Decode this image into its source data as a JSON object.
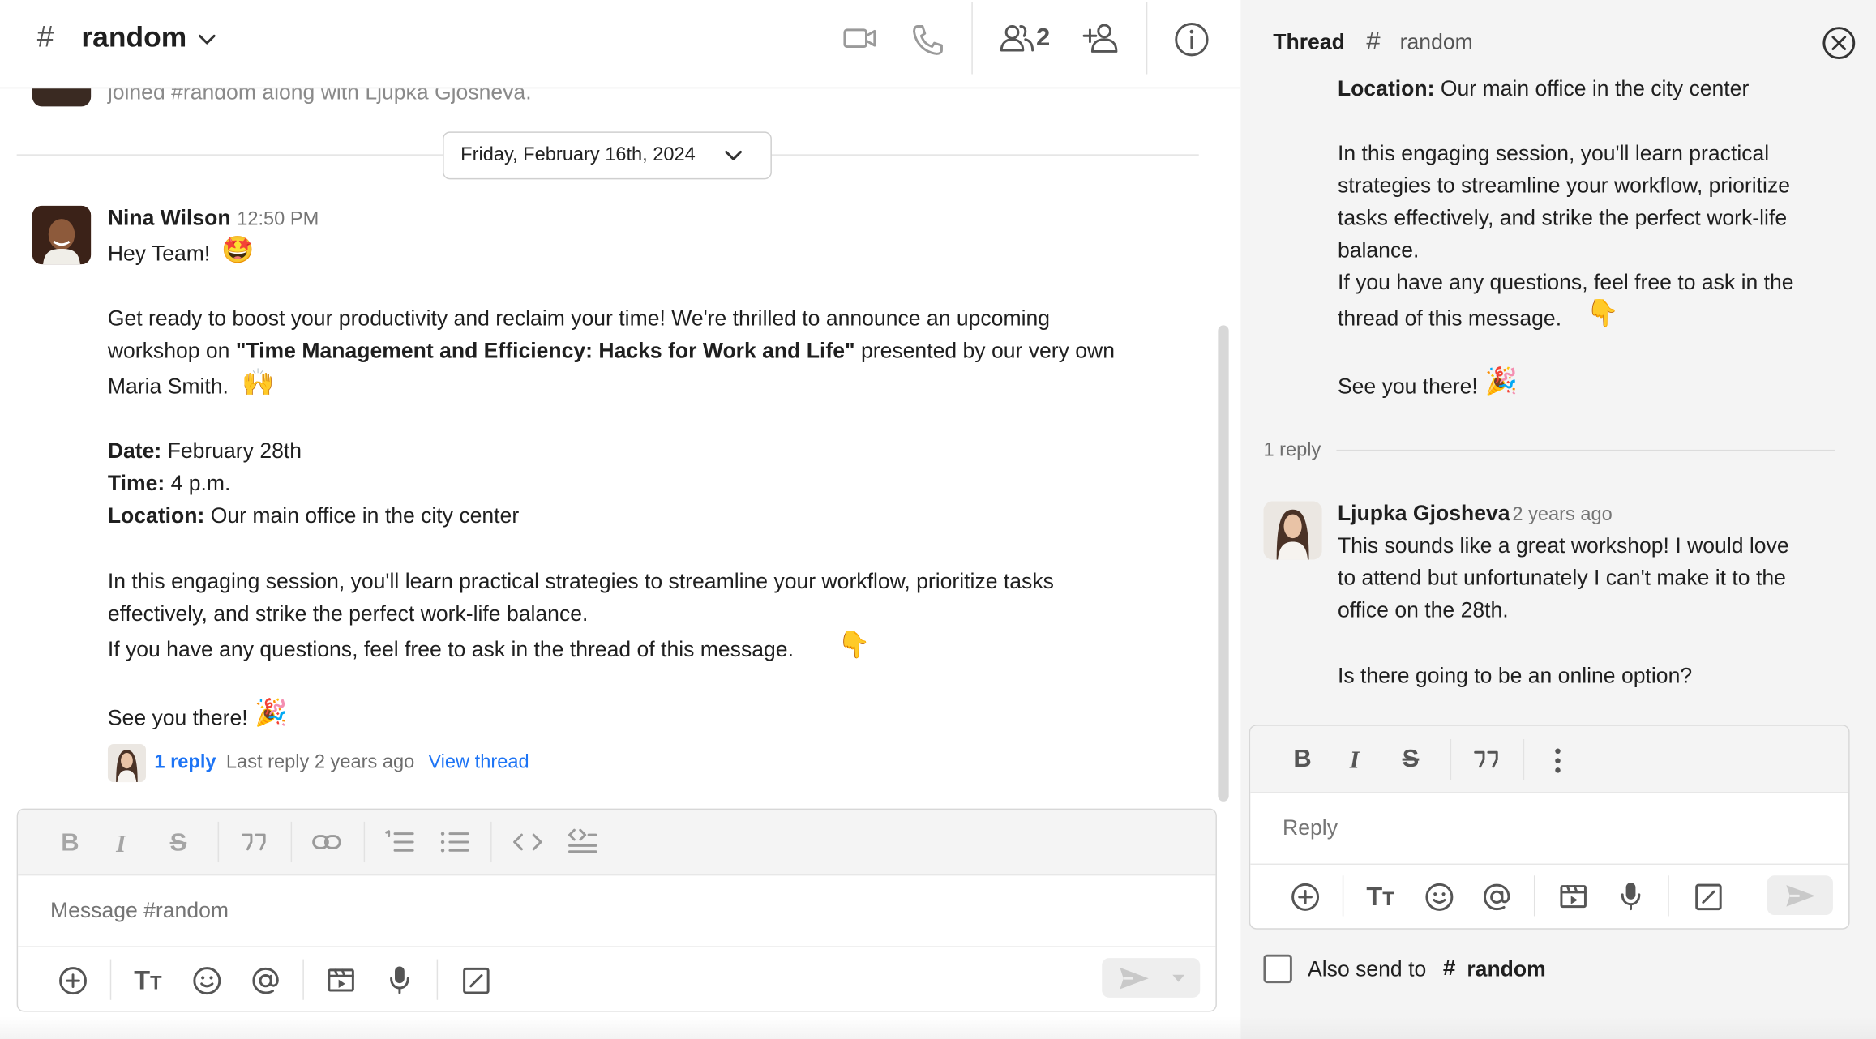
{
  "channel": {
    "hash": "#",
    "name": "random",
    "member_count": "2"
  },
  "top_faded": "joined #random along with Ljupka Gjosheva.",
  "date_divider": "Friday, February 16th, 2024",
  "message": {
    "author": "Nina Wilson",
    "time": "12:50 PM",
    "greeting": "Hey Team!",
    "emoji_greeting": "🤩",
    "p1a": "Get ready to boost your productivity and reclaim your time! We're thrilled to announce an upcoming",
    "p1b_pre": "workshop on ",
    "p1b_bold": "\"Time Management and Efficiency: Hacks for Work and Life\"",
    "p1b_post": " presented by our very own",
    "p1c": "Maria Smith.",
    "emoji_hands": "🙌",
    "date_label": "Date:",
    "date_value": " February 28th",
    "time_label": "Time:",
    "time_value": " 4 p.m.",
    "location_label": "Location:",
    "location_value": " Our main office in the city center",
    "p2a": "In this engaging session, you'll learn practical strategies to streamline your workflow, prioritize tasks",
    "p2b": "effectively, and strike the perfect work-life balance.",
    "p3": "If you have any questions, feel free to ask in the thread of this message.",
    "emoji_point": "👇",
    "p4": "See you there!",
    "emoji_party": "🎉",
    "reply_count": "1 reply",
    "last_reply": "Last reply 2 years ago",
    "view_thread": "View thread"
  },
  "composer": {
    "placeholder": "Message #random"
  },
  "thread": {
    "title": "Thread",
    "hash": "#",
    "channel": "random",
    "loc_label": "Location:",
    "loc_value": " Our main office in the city center",
    "l1": "In this engaging session, you'll learn practical",
    "l2": "strategies to streamline your workflow, prioritize",
    "l3": "tasks effectively, and strike the perfect work-life",
    "l4": "balance.",
    "l5": "If you have any questions, feel free to ask in the",
    "l6": "thread of this message.",
    "emoji_point": "👇",
    "l7": "See you there!",
    "emoji_party": "🎉",
    "reply_divider": "1 reply",
    "reply": {
      "author": "Ljupka Gjosheva",
      "time": "2 years ago",
      "r1": "This sounds like a great workshop! I would love",
      "r2": "to attend but unfortunately I can't make it to the",
      "r3": "office on  the 28th.",
      "r4": "Is there going to be an online option?"
    },
    "reply_placeholder": "Reply",
    "also_send_label": "Also send to",
    "also_send_hash": "#",
    "also_send_channel": "random"
  },
  "colors": {
    "link": "#1d74f5",
    "text": "#1f1f1f",
    "muted": "#6e6e6e",
    "panel": "#f4f4f4"
  }
}
